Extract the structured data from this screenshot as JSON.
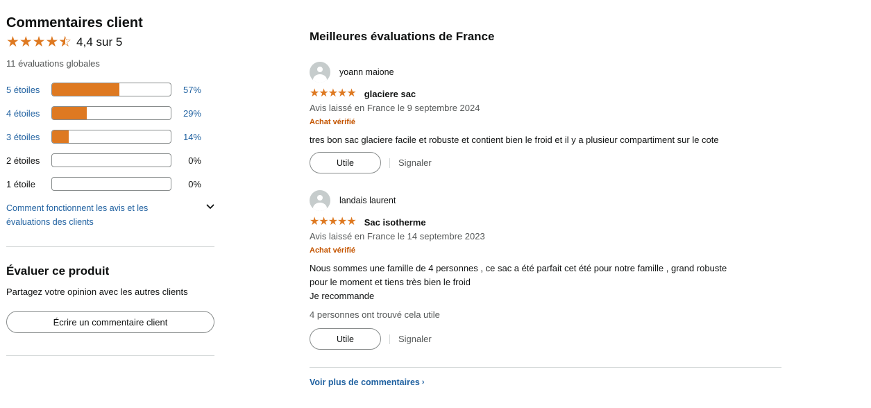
{
  "left": {
    "title": "Commentaires client",
    "average_stars": 4.4,
    "average_text": "4,4 sur 5",
    "global_count": "11 évaluations globales",
    "histogram": [
      {
        "label": "5 étoiles",
        "pct": 57,
        "pct_text": "57%",
        "link": true
      },
      {
        "label": "4 étoiles",
        "pct": 29,
        "pct_text": "29%",
        "link": true
      },
      {
        "label": "3 étoiles",
        "pct": 14,
        "pct_text": "14%",
        "link": true
      },
      {
        "label": "2 étoiles",
        "pct": 0,
        "pct_text": "0%",
        "link": false
      },
      {
        "label": "1 étoile",
        "pct": 0,
        "pct_text": "0%",
        "link": false
      }
    ],
    "how_it_works": "Comment fonctionnent les avis et les évaluations des clients",
    "evaluate": {
      "title": "Évaluer ce produit",
      "subtitle": "Partagez votre opinion avec les autres clients",
      "button": "Écrire un commentaire client"
    }
  },
  "right": {
    "title": "Meilleures évaluations de France",
    "reviews": [
      {
        "name": "yoann maione",
        "stars": 5,
        "title": "glaciere sac",
        "date": "Avis laissé en France le 9 septembre 2024",
        "verified": "Achat vérifié",
        "body": [
          "tres bon sac glaciere facile et robuste et contient bien le froid et il y a plusieur compartiment sur le cote"
        ],
        "found_helpful": "",
        "helpful_button": "Utile",
        "report": "Signaler"
      },
      {
        "name": "landais laurent",
        "stars": 5,
        "title": "Sac isotherme",
        "date": "Avis laissé en France le 14 septembre 2023",
        "verified": "Achat vérifié",
        "body": [
          "Nous sommes une famille de 4 personnes , ce sac a été parfait cet été pour notre famille , grand robuste",
          "pour le moment et tiens très bien le froid",
          "Je recommande"
        ],
        "found_helpful": "4 personnes ont trouvé cela utile",
        "helpful_button": "Utile",
        "report": "Signaler"
      }
    ],
    "see_more": "Voir plus de commentaires"
  },
  "colors": {
    "star": "#de7921",
    "link": "#2162a1",
    "verified": "#c45500",
    "muted": "#565959"
  }
}
